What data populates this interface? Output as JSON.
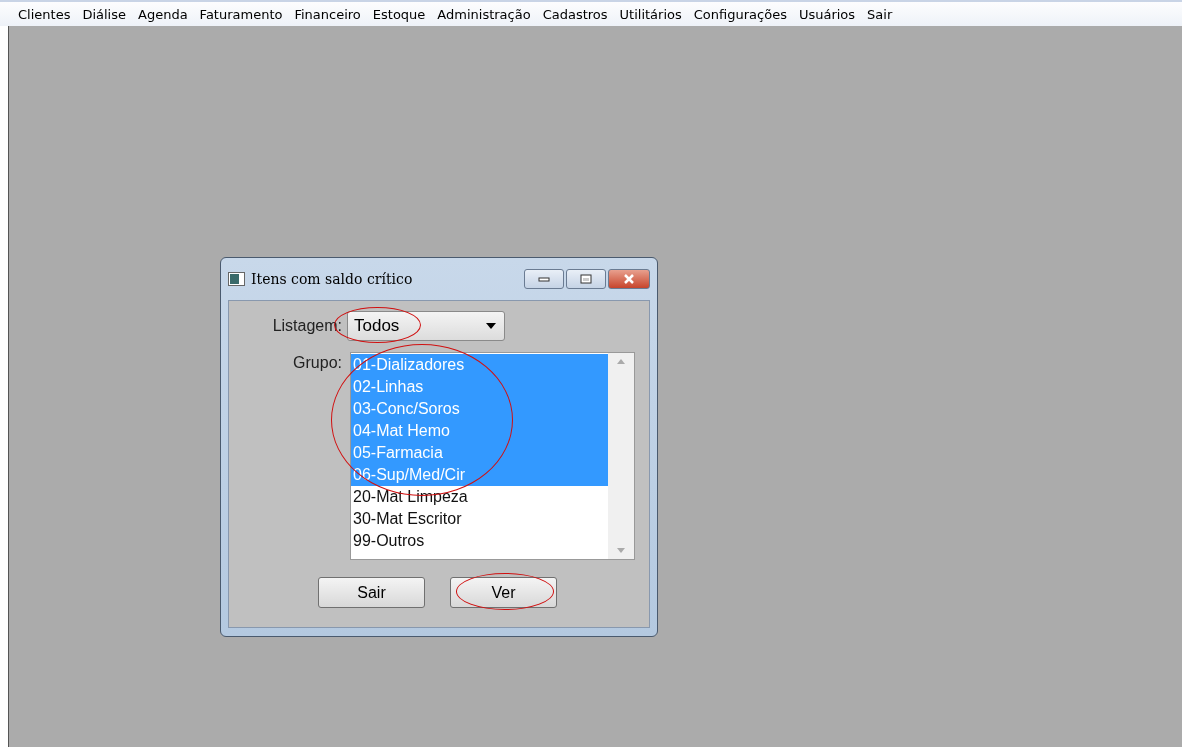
{
  "menu": [
    {
      "label": "Clientes"
    },
    {
      "label": "Diálise"
    },
    {
      "label": "Agenda"
    },
    {
      "label": "Faturamento"
    },
    {
      "label": "Financeiro"
    },
    {
      "label": "Estoque"
    },
    {
      "label": "Administração"
    },
    {
      "label": "Cadastros"
    },
    {
      "label": "Utilitários"
    },
    {
      "label": "Configurações"
    },
    {
      "label": "Usuários"
    },
    {
      "label": "Sair"
    }
  ],
  "dialog": {
    "title": "Itens com saldo crítico",
    "listagem": {
      "label": "Listagem:",
      "value": "Todos"
    },
    "grupo": {
      "label": "Grupo:",
      "items": [
        {
          "label": "01-Dializadores",
          "selected": true
        },
        {
          "label": "02-Linhas",
          "selected": true
        },
        {
          "label": "03-Conc/Soros",
          "selected": true
        },
        {
          "label": "04-Mat Hemo",
          "selected": true
        },
        {
          "label": "05-Farmacia",
          "selected": true
        },
        {
          "label": "06-Sup/Med/Cir",
          "selected": true
        },
        {
          "label": "20-Mat Limpeza",
          "selected": false
        },
        {
          "label": "30-Mat Escritor",
          "selected": false
        },
        {
          "label": "99-Outros",
          "selected": false
        }
      ]
    },
    "buttons": [
      {
        "label": "Sair"
      },
      {
        "label": "Ver"
      }
    ]
  }
}
